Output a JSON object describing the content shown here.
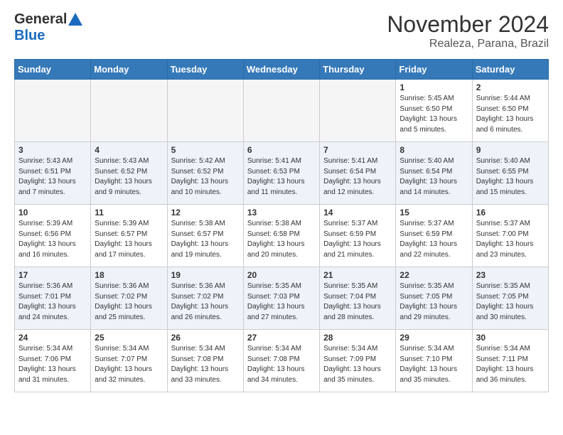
{
  "header": {
    "logo_general": "General",
    "logo_blue": "Blue",
    "month_title": "November 2024",
    "location": "Realeza, Parana, Brazil"
  },
  "calendar": {
    "weekdays": [
      "Sunday",
      "Monday",
      "Tuesday",
      "Wednesday",
      "Thursday",
      "Friday",
      "Saturday"
    ],
    "weeks": [
      [
        {
          "day": "",
          "info": ""
        },
        {
          "day": "",
          "info": ""
        },
        {
          "day": "",
          "info": ""
        },
        {
          "day": "",
          "info": ""
        },
        {
          "day": "",
          "info": ""
        },
        {
          "day": "1",
          "info": "Sunrise: 5:45 AM\nSunset: 6:50 PM\nDaylight: 13 hours and 5 minutes."
        },
        {
          "day": "2",
          "info": "Sunrise: 5:44 AM\nSunset: 6:50 PM\nDaylight: 13 hours and 6 minutes."
        }
      ],
      [
        {
          "day": "3",
          "info": "Sunrise: 5:43 AM\nSunset: 6:51 PM\nDaylight: 13 hours and 7 minutes."
        },
        {
          "day": "4",
          "info": "Sunrise: 5:43 AM\nSunset: 6:52 PM\nDaylight: 13 hours and 9 minutes."
        },
        {
          "day": "5",
          "info": "Sunrise: 5:42 AM\nSunset: 6:52 PM\nDaylight: 13 hours and 10 minutes."
        },
        {
          "day": "6",
          "info": "Sunrise: 5:41 AM\nSunset: 6:53 PM\nDaylight: 13 hours and 11 minutes."
        },
        {
          "day": "7",
          "info": "Sunrise: 5:41 AM\nSunset: 6:54 PM\nDaylight: 13 hours and 12 minutes."
        },
        {
          "day": "8",
          "info": "Sunrise: 5:40 AM\nSunset: 6:54 PM\nDaylight: 13 hours and 14 minutes."
        },
        {
          "day": "9",
          "info": "Sunrise: 5:40 AM\nSunset: 6:55 PM\nDaylight: 13 hours and 15 minutes."
        }
      ],
      [
        {
          "day": "10",
          "info": "Sunrise: 5:39 AM\nSunset: 6:56 PM\nDaylight: 13 hours and 16 minutes."
        },
        {
          "day": "11",
          "info": "Sunrise: 5:39 AM\nSunset: 6:57 PM\nDaylight: 13 hours and 17 minutes."
        },
        {
          "day": "12",
          "info": "Sunrise: 5:38 AM\nSunset: 6:57 PM\nDaylight: 13 hours and 19 minutes."
        },
        {
          "day": "13",
          "info": "Sunrise: 5:38 AM\nSunset: 6:58 PM\nDaylight: 13 hours and 20 minutes."
        },
        {
          "day": "14",
          "info": "Sunrise: 5:37 AM\nSunset: 6:59 PM\nDaylight: 13 hours and 21 minutes."
        },
        {
          "day": "15",
          "info": "Sunrise: 5:37 AM\nSunset: 6:59 PM\nDaylight: 13 hours and 22 minutes."
        },
        {
          "day": "16",
          "info": "Sunrise: 5:37 AM\nSunset: 7:00 PM\nDaylight: 13 hours and 23 minutes."
        }
      ],
      [
        {
          "day": "17",
          "info": "Sunrise: 5:36 AM\nSunset: 7:01 PM\nDaylight: 13 hours and 24 minutes."
        },
        {
          "day": "18",
          "info": "Sunrise: 5:36 AM\nSunset: 7:02 PM\nDaylight: 13 hours and 25 minutes."
        },
        {
          "day": "19",
          "info": "Sunrise: 5:36 AM\nSunset: 7:02 PM\nDaylight: 13 hours and 26 minutes."
        },
        {
          "day": "20",
          "info": "Sunrise: 5:35 AM\nSunset: 7:03 PM\nDaylight: 13 hours and 27 minutes."
        },
        {
          "day": "21",
          "info": "Sunrise: 5:35 AM\nSunset: 7:04 PM\nDaylight: 13 hours and 28 minutes."
        },
        {
          "day": "22",
          "info": "Sunrise: 5:35 AM\nSunset: 7:05 PM\nDaylight: 13 hours and 29 minutes."
        },
        {
          "day": "23",
          "info": "Sunrise: 5:35 AM\nSunset: 7:05 PM\nDaylight: 13 hours and 30 minutes."
        }
      ],
      [
        {
          "day": "24",
          "info": "Sunrise: 5:34 AM\nSunset: 7:06 PM\nDaylight: 13 hours and 31 minutes."
        },
        {
          "day": "25",
          "info": "Sunrise: 5:34 AM\nSunset: 7:07 PM\nDaylight: 13 hours and 32 minutes."
        },
        {
          "day": "26",
          "info": "Sunrise: 5:34 AM\nSunset: 7:08 PM\nDaylight: 13 hours and 33 minutes."
        },
        {
          "day": "27",
          "info": "Sunrise: 5:34 AM\nSunset: 7:08 PM\nDaylight: 13 hours and 34 minutes."
        },
        {
          "day": "28",
          "info": "Sunrise: 5:34 AM\nSunset: 7:09 PM\nDaylight: 13 hours and 35 minutes."
        },
        {
          "day": "29",
          "info": "Sunrise: 5:34 AM\nSunset: 7:10 PM\nDaylight: 13 hours and 35 minutes."
        },
        {
          "day": "30",
          "info": "Sunrise: 5:34 AM\nSunset: 7:11 PM\nDaylight: 13 hours and 36 minutes."
        }
      ]
    ]
  }
}
